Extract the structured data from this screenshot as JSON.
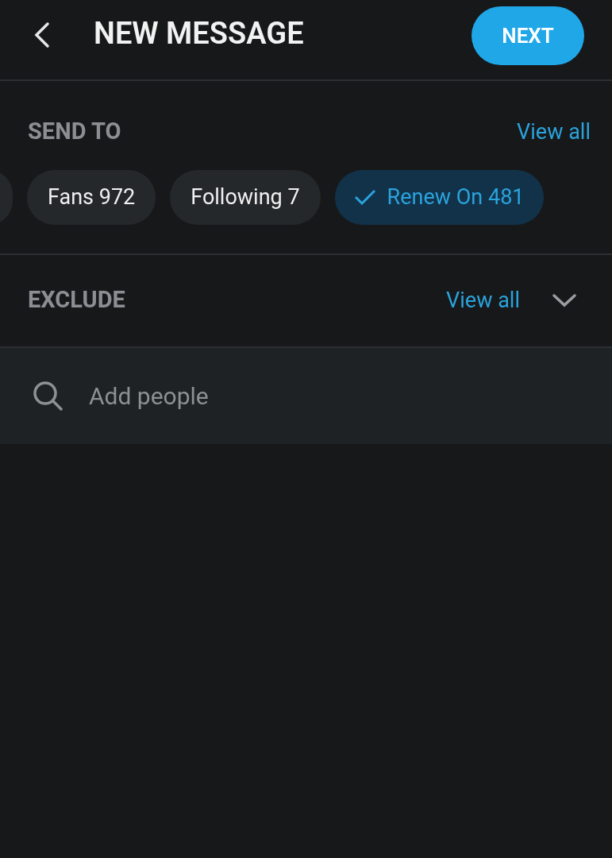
{
  "header": {
    "title": "NEW MESSAGE",
    "next_button": "NEXT"
  },
  "send_to": {
    "heading": "SEND TO",
    "view_all": "View all",
    "chips": [
      {
        "label": "Fans 972",
        "selected": false
      },
      {
        "label": "Following 7",
        "selected": false
      },
      {
        "label": "Renew On 481",
        "selected": true
      }
    ]
  },
  "exclude": {
    "heading": "EXCLUDE",
    "view_all": "View all",
    "expanded": false
  },
  "search": {
    "placeholder": "Add people"
  }
}
